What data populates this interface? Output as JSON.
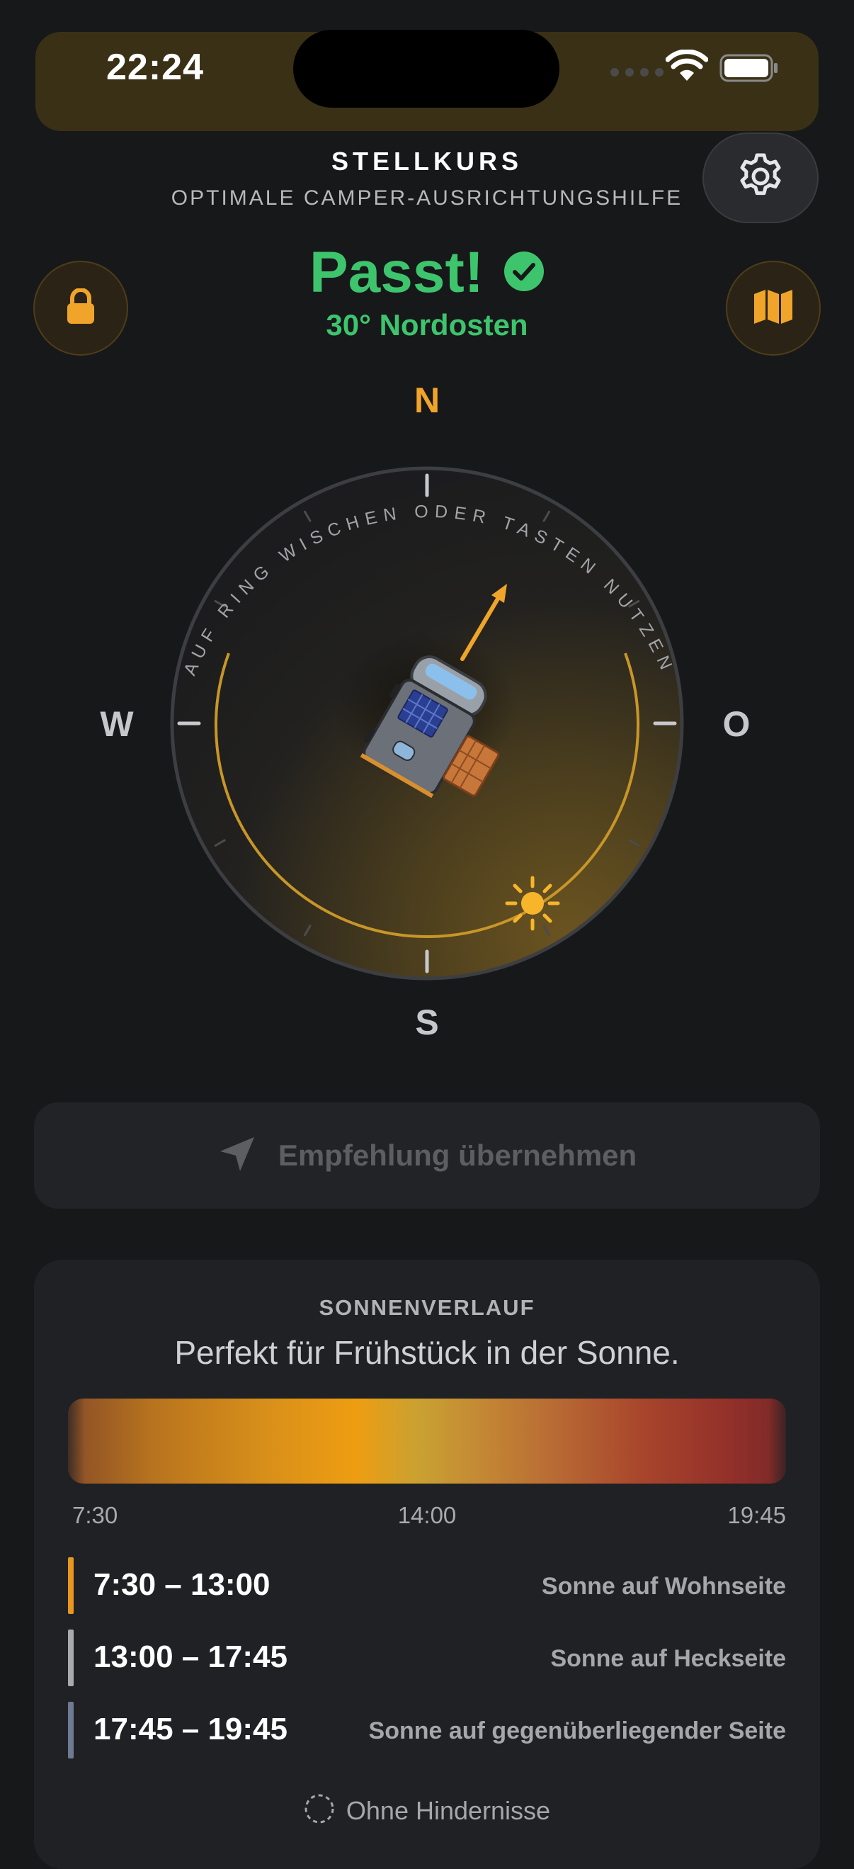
{
  "status_bar": {
    "time": "22:24"
  },
  "header": {
    "title": "STELLKURS",
    "subtitle": "OPTIMALE CAMPER-AUSRICHTUNGSHILFE"
  },
  "alignment_status": {
    "title": "Passt!",
    "detail": "30° Nordosten",
    "color": "#3ec46d"
  },
  "compass": {
    "hint": "AUF RING WISCHEN ODER TASTEN NUTZEN",
    "north": "N",
    "east": "O",
    "south": "S",
    "west": "W",
    "heading_deg": 30,
    "accent": "#f0a52a"
  },
  "apply_button": {
    "label": "Empfehlung übernehmen"
  },
  "sun_card": {
    "title": "SONNENVERLAUF",
    "subtitle": "Perfekt für Frühstück in der Sonne.",
    "ticks": [
      "7:30",
      "14:00",
      "19:45"
    ],
    "rows": [
      {
        "time": "7:30 – 13:00",
        "desc": "Sonne auf Wohnseite",
        "color": "#e8961e"
      },
      {
        "time": "13:00 – 17:45",
        "desc": "Sonne auf Heckseite",
        "color": "#a9a9ae"
      },
      {
        "time": "17:45 – 19:45",
        "desc": "Sonne auf gegenüberliegender Seite",
        "color": "#6e7a92"
      }
    ],
    "obstacle_label": "Ohne Hindernisse"
  }
}
